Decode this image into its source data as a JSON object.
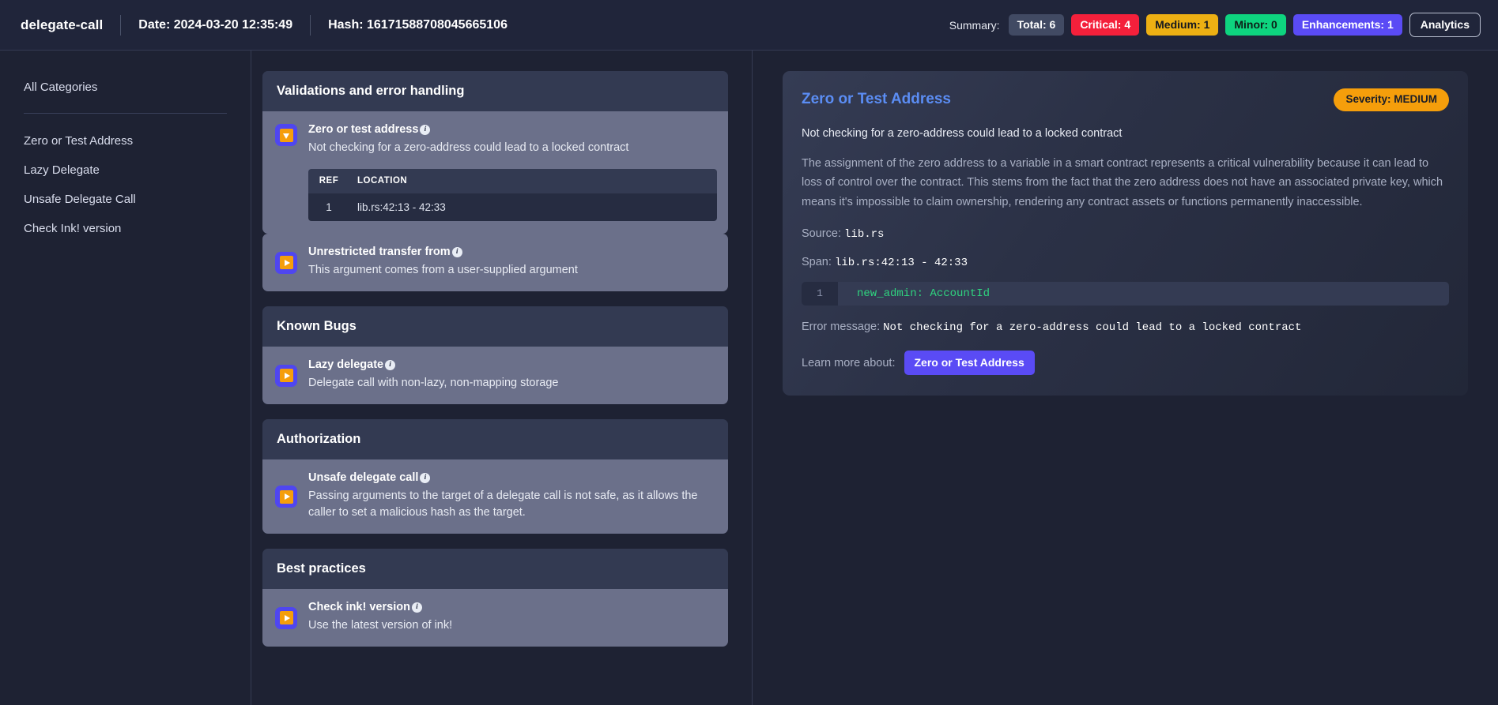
{
  "header": {
    "project": "delegate-call",
    "date": "Date: 2024-03-20 12:35:49",
    "hash": "Hash: 16171588708045665106",
    "summary_label": "Summary:",
    "badges": [
      {
        "label": "Total: 6",
        "name": "total",
        "color": "#414a63"
      },
      {
        "label": "Critical: 4",
        "name": "critical",
        "color": "#f4203b"
      },
      {
        "label": "Medium: 1",
        "name": "medium",
        "color": "#edb013"
      },
      {
        "label": "Minor: 0",
        "name": "minor",
        "color": "#0ed47f"
      },
      {
        "label": "Enhancements: 1",
        "name": "enhancements",
        "color": "#5a4bf5"
      }
    ],
    "analytics_label": "Analytics"
  },
  "sidebar": {
    "all_categories": "All Categories",
    "items": [
      {
        "label": "Zero or Test Address"
      },
      {
        "label": "Lazy Delegate"
      },
      {
        "label": "Unsafe Delegate Call"
      },
      {
        "label": "Check Ink! version"
      }
    ]
  },
  "sections": [
    {
      "title": "Validations and error handling",
      "findings": [
        {
          "title": "Zero or test address",
          "desc": "Not checking for a zero-address could lead to a locked contract",
          "expanded": true,
          "table": {
            "columns": [
              "REF",
              "LOCATION"
            ],
            "rows": [
              {
                "ref": "1",
                "location": "lib.rs:42:13 - 42:33"
              }
            ]
          }
        },
        {
          "title": "Unrestricted transfer from",
          "desc": "This argument comes from a user-supplied argument",
          "expanded": false
        }
      ]
    },
    {
      "title": "Known Bugs",
      "findings": [
        {
          "title": "Lazy delegate",
          "desc": "Delegate call with non-lazy, non-mapping storage",
          "expanded": false
        }
      ]
    },
    {
      "title": "Authorization",
      "findings": [
        {
          "title": "Unsafe delegate call",
          "desc": "Passing arguments to the target of a delegate call is not safe, as it allows the caller to set a malicious hash as the target.",
          "expanded": false
        }
      ]
    },
    {
      "title": "Best practices",
      "findings": [
        {
          "title": "Check ink! version",
          "desc": "Use the latest version of ink!",
          "expanded": false
        }
      ]
    }
  ],
  "detail": {
    "title": "Zero or Test Address",
    "severity_badge": "Severity: MEDIUM",
    "subtitle": "Not checking for a zero-address could lead to a locked contract",
    "description": "The assignment of the zero address to a variable in a smart contract represents a critical vulnerability because it can lead to loss of control over the contract. This stems from the fact that the zero address does not have an associated private key, which means it's impossible to claim ownership, rendering any contract assets or functions permanently inaccessible.",
    "source_label": "Source:",
    "source_value": "lib.rs",
    "span_label": "Span:",
    "span_value": "lib.rs:42:13 - 42:33",
    "code_line_number": "1",
    "code_line_text": "new_admin: AccountId",
    "error_label": "Error message:",
    "error_value": "Not checking for a zero-address could lead to a locked contract",
    "learn_label": "Learn more about:",
    "learn_button": "Zero or Test Address"
  }
}
